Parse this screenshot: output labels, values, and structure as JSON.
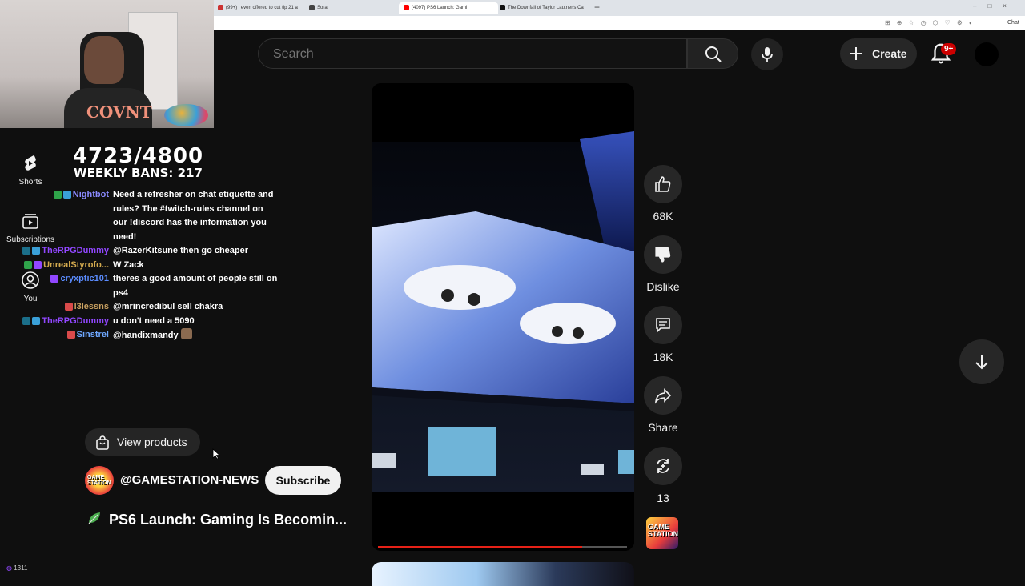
{
  "browser": {
    "tabs": [
      {
        "label": "(99+) i even offered to cut tip 21 a",
        "color": "#cc3333",
        "active": false
      },
      {
        "label": "Sora",
        "color": "#444444",
        "active": false
      },
      {
        "label": "(4097) PS6 Launch: Gami",
        "color": "#ff0000",
        "active": true
      },
      {
        "label": "The Downfall of Taylor Lautner's Ca",
        "color": "#111111",
        "active": false
      }
    ],
    "chat_label": "Chat"
  },
  "webcam": {
    "shirt_text": "COVNT"
  },
  "sidebar": {
    "items": [
      {
        "label": "Shorts",
        "icon": "shorts-icon"
      },
      {
        "label": "Subscriptions",
        "icon": "subscriptions-icon"
      },
      {
        "label": "You",
        "icon": "you-icon"
      }
    ]
  },
  "overlay": {
    "count": "4723/4800",
    "weekly_bans": "WEEKLY BANS: 217"
  },
  "chat": {
    "messages": [
      {
        "user": "Nightbot",
        "color": "#8a8aff",
        "text": "Need a refresher on chat etiquette and rules? The #twitch-rules channel on our !discord has the information you need!"
      },
      {
        "user": "TheRPGDummy",
        "color": "#9147ff",
        "text": "@RazerKitsune then go cheaper"
      },
      {
        "user": "UnrealStyrofo...",
        "color": "#d2a94e",
        "text": "W Zack"
      },
      {
        "user": "cryxptic101",
        "color": "#5b8cff",
        "text": "theres a good amount of people still on ps4"
      },
      {
        "user": "l3lessns",
        "color": "#c8a060",
        "text": "@mrincredibul sell chakra"
      },
      {
        "user": "TheRPGDummy",
        "color": "#9147ff",
        "text": "u don't need a 5090"
      },
      {
        "user": "Sinstrel",
        "color": "#6fa8ff",
        "text": "@handixmandy"
      }
    ]
  },
  "header": {
    "search_placeholder": "Search",
    "create_label": "Create",
    "notification_count": "9+"
  },
  "video": {
    "progress": 0.82
  },
  "actions": {
    "like_count": "68K",
    "dislike_label": "Dislike",
    "comment_count": "18K",
    "share_label": "Share",
    "remix_count": "13"
  },
  "channel": {
    "view_products": "View products",
    "handle": "@GAMESTATION-NEWS",
    "subscribe": "Subscribe",
    "logo_text": "GAME STATION",
    "title": "PS6 Launch: Gaming Is Becomin..."
  },
  "footer": {
    "viewers": "1311"
  }
}
